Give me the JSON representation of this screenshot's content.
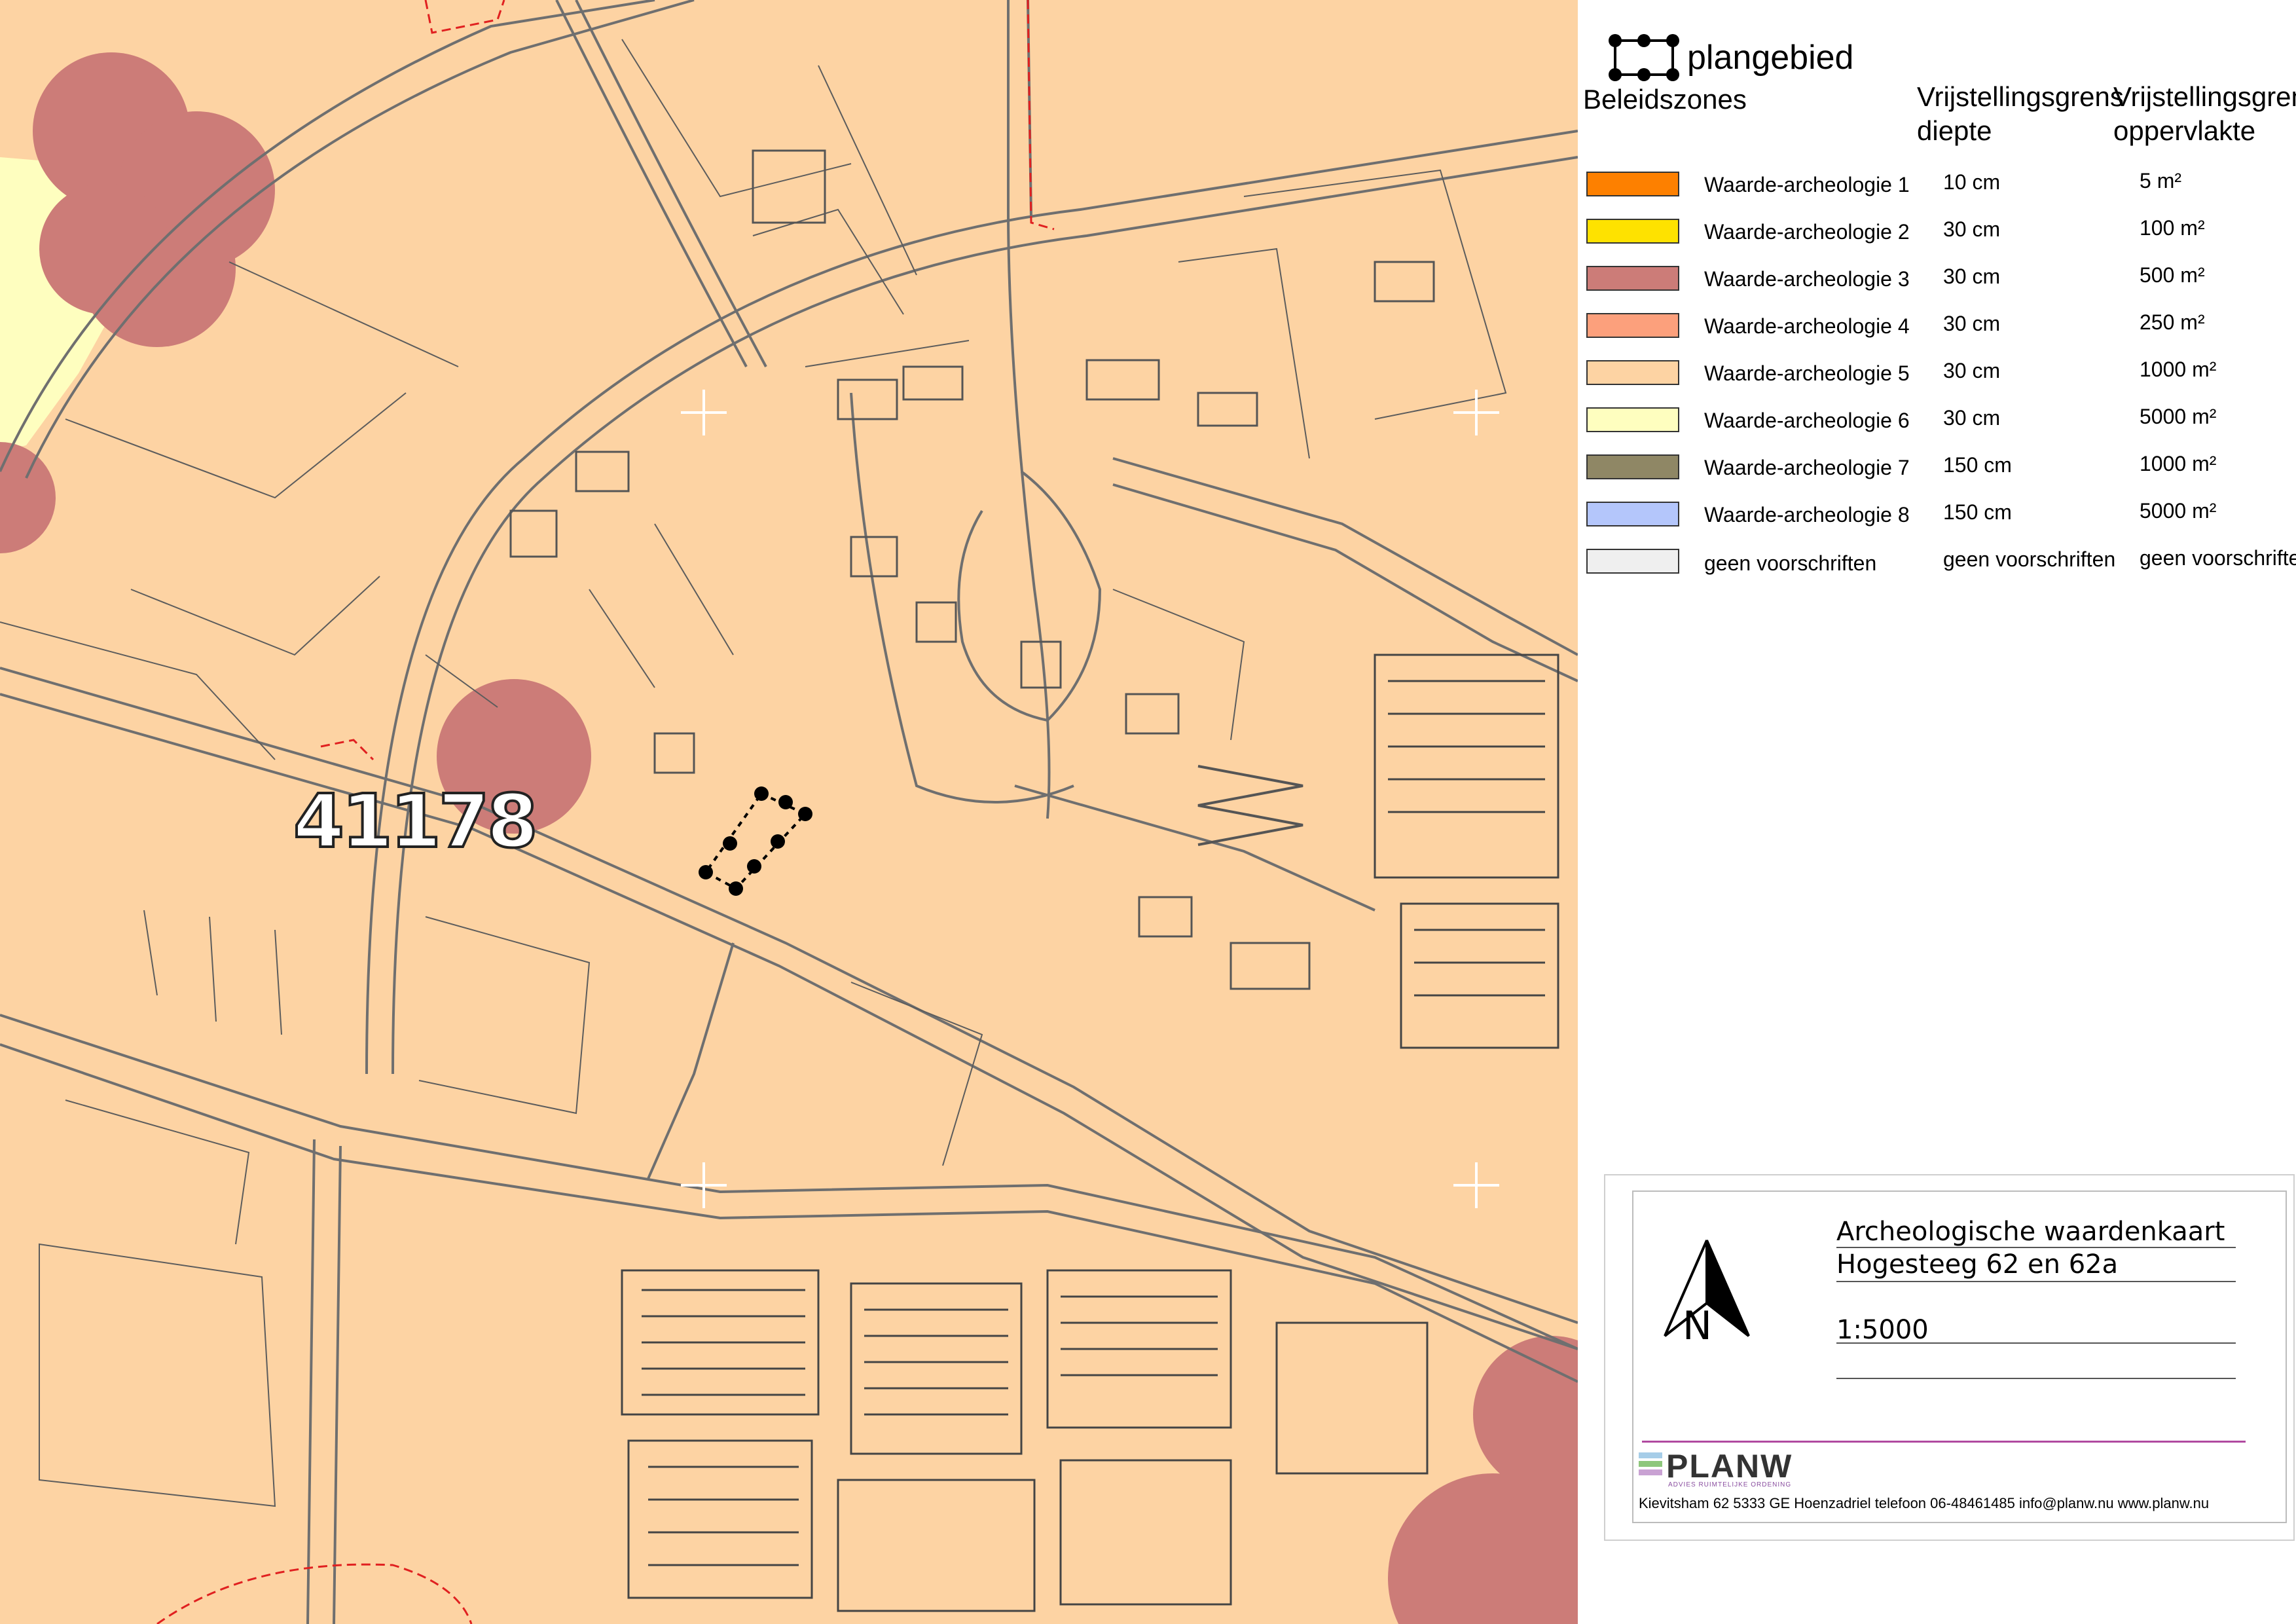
{
  "map": {
    "parcel_label": "41178",
    "zone_colors": {
      "waarde_3": "#cc7c78",
      "waarde_5": "#fdd3a3",
      "waarde_6": "#fefebf"
    }
  },
  "legend": {
    "plan_label": "plangebied",
    "zones_title": "Beleidszones",
    "col_depth": "Vrijstellingsgrens\ndiepte",
    "col_area": "Vrijstellingsgrens\noppervlakte",
    "zones": [
      {
        "name": "Waarde-archeologie 1",
        "depth": "10 cm",
        "area": "5 m²",
        "color": "#fd8000"
      },
      {
        "name": "Waarde-archeologie 2",
        "depth": "30 cm",
        "area": "100 m²",
        "color": "#fee200"
      },
      {
        "name": "Waarde-archeologie 3",
        "depth": "30 cm",
        "area": "500 m²",
        "color": "#cc7c78"
      },
      {
        "name": "Waarde-archeologie 4",
        "depth": "30 cm",
        "area": "250 m²",
        "color": "#fca07c"
      },
      {
        "name": "Waarde-archeologie 5",
        "depth": "30 cm",
        "area": "1000 m²",
        "color": "#fdd3a3"
      },
      {
        "name": "Waarde-archeologie 6",
        "depth": "30 cm",
        "area": "5000 m²",
        "color": "#fefebf"
      },
      {
        "name": "Waarde-archeologie 7",
        "depth": "150 cm",
        "area": "1000 m²",
        "color": "#8f8765"
      },
      {
        "name": "Waarde-archeologie 8",
        "depth": "150 cm",
        "area": "5000 m²",
        "color": "#b4c6fb"
      },
      {
        "name": "geen voorschriften",
        "depth": "geen voorschriften",
        "area": "geen voorschriften",
        "color": "#efefef"
      }
    ]
  },
  "title_block": {
    "line1": "Archeologische waardenkaart",
    "line2": "Hogesteeg 62 en 62a",
    "scale": "1:5000",
    "north_label": "N",
    "logo": "PLANW",
    "logo_sub": "ADVIES RUIMTELIJKE ORDENING",
    "footer": "Kievitsham 62 5333 GE Hoenzadriel telefoon 06-48461485 info@planw.nu www.planw.nu"
  }
}
